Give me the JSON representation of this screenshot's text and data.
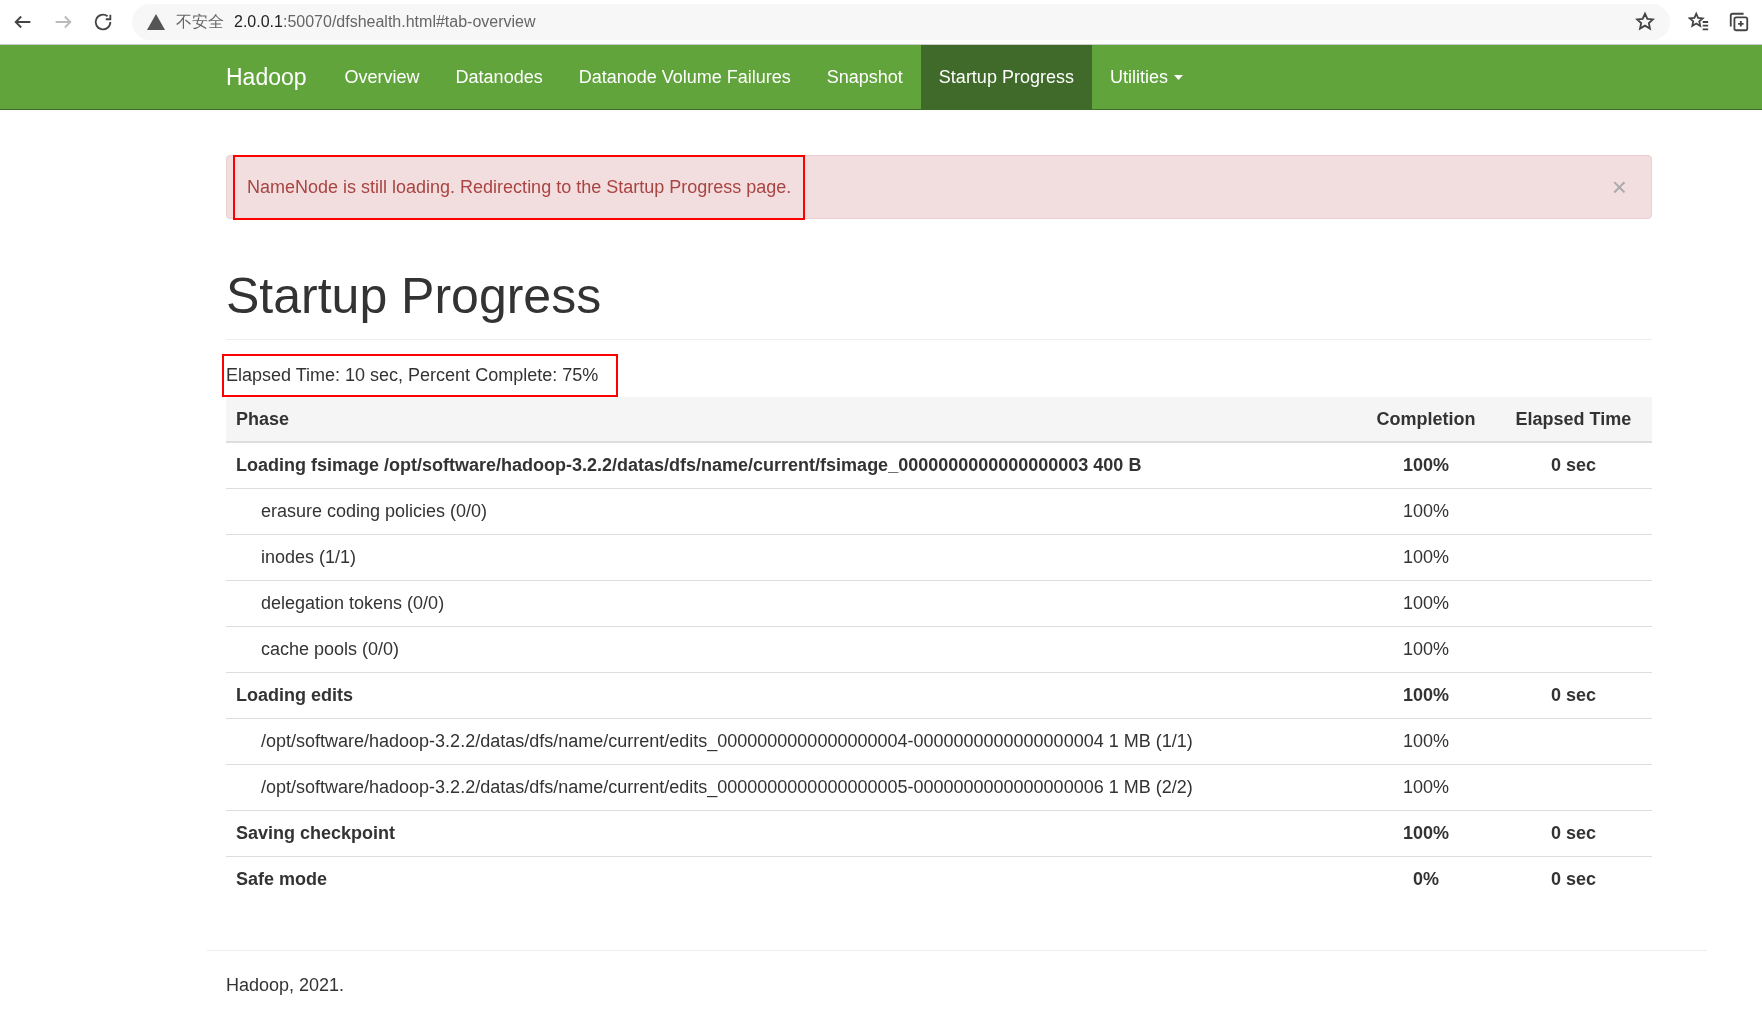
{
  "browser": {
    "security_label": "不安全",
    "host": "2.0.0.1",
    "path": ":50070/dfshealth.html#tab-overview"
  },
  "navbar": {
    "brand": "Hadoop",
    "items": [
      {
        "label": "Overview",
        "selected": false,
        "kind": "link"
      },
      {
        "label": "Datanodes",
        "selected": false,
        "kind": "link"
      },
      {
        "label": "Datanode Volume Failures",
        "selected": false,
        "kind": "link"
      },
      {
        "label": "Snapshot",
        "selected": false,
        "kind": "link"
      },
      {
        "label": "Startup Progress",
        "selected": true,
        "kind": "link"
      },
      {
        "label": "Utilities",
        "selected": false,
        "kind": "dropdown"
      }
    ]
  },
  "alert": {
    "message": "NameNode is still loading. Redirecting to the Startup Progress page.",
    "close": "×",
    "highlighted": true
  },
  "title": "Startup Progress",
  "summary": {
    "text": "Elapsed Time: 10 sec, Percent Complete: 75%",
    "highlighted": true
  },
  "table": {
    "columns": [
      "Phase",
      "Completion",
      "Elapsed Time"
    ],
    "rows": [
      {
        "phase": "Loading fsimage /opt/software/hadoop-3.2.2/datas/dfs/name/current/fsimage_0000000000000000003 400 B",
        "completion": "100%",
        "elapsed": "0 sec",
        "children": [
          {
            "phase": "erasure coding policies (0/0)",
            "completion": "100%"
          },
          {
            "phase": "inodes (1/1)",
            "completion": "100%"
          },
          {
            "phase": "delegation tokens (0/0)",
            "completion": "100%"
          },
          {
            "phase": "cache pools (0/0)",
            "completion": "100%"
          }
        ]
      },
      {
        "phase": "Loading edits",
        "completion": "100%",
        "elapsed": "0 sec",
        "children": [
          {
            "phase": "/opt/software/hadoop-3.2.2/datas/dfs/name/current/edits_0000000000000000004-0000000000000000004 1 MB (1/1)",
            "completion": "100%"
          },
          {
            "phase": "/opt/software/hadoop-3.2.2/datas/dfs/name/current/edits_0000000000000000005-0000000000000000006 1 MB (2/2)",
            "completion": "100%"
          }
        ]
      },
      {
        "phase": "Saving checkpoint",
        "completion": "100%",
        "elapsed": "0 sec"
      },
      {
        "phase": "Safe mode",
        "completion": "0%",
        "elapsed": "0 sec"
      }
    ]
  },
  "footer": "Hadoop, 2021."
}
